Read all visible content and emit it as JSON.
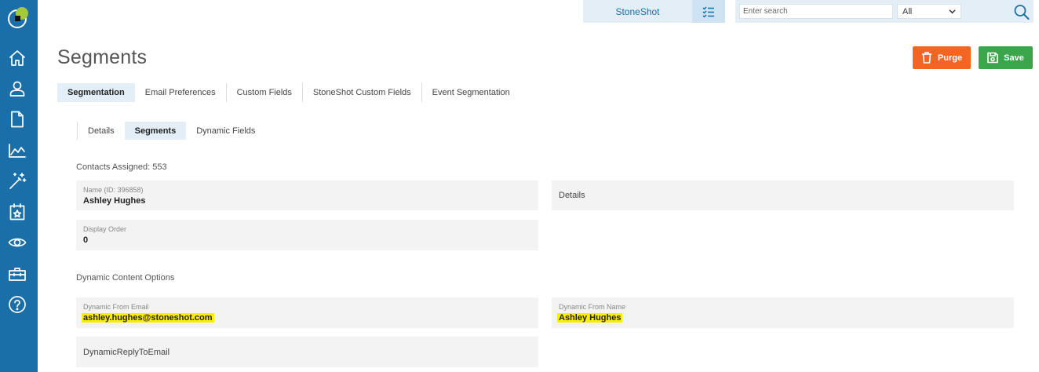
{
  "topbar": {
    "brand": "StoneShot",
    "search_placeholder": "Enter search",
    "filter_value": "All"
  },
  "page": {
    "title": "Segments",
    "purge_label": "Purge",
    "save_label": "Save"
  },
  "tabs": [
    {
      "label": "Segmentation",
      "active": true
    },
    {
      "label": "Email Preferences"
    },
    {
      "label": "Custom Fields"
    },
    {
      "label": "StoneShot Custom Fields"
    },
    {
      "label": "Event Segmentation"
    }
  ],
  "subtabs": [
    {
      "label": "Details"
    },
    {
      "label": "Segments",
      "active": true
    },
    {
      "label": "Dynamic Fields"
    }
  ],
  "contacts_assigned": "Contacts Assigned: 553",
  "fields": {
    "name_label": "Name (ID: 396858)",
    "name_value": "Ashley Hughes",
    "details_label": "Details",
    "display_order_label": "Display Order",
    "display_order_value": "0"
  },
  "dynamic": {
    "section_title": "Dynamic Content Options",
    "from_email_label": "Dynamic From Email",
    "from_email_value": "ashley.hughes@stoneshot.com",
    "from_name_label": "Dynamic From Name",
    "from_name_value": "Ashley Hughes",
    "reply_to_label": "DynamicReplyToEmail"
  },
  "colors": {
    "sidebar": "#1b6fa8",
    "purge": "#f26522",
    "save": "#3aa54a",
    "highlight": "#ffee00"
  },
  "sidebar_icons": [
    "home-icon",
    "user-icon",
    "document-icon",
    "chart-icon",
    "magic-wand-icon",
    "calendar-star-icon",
    "eye-icon",
    "toolbox-icon",
    "help-icon"
  ]
}
